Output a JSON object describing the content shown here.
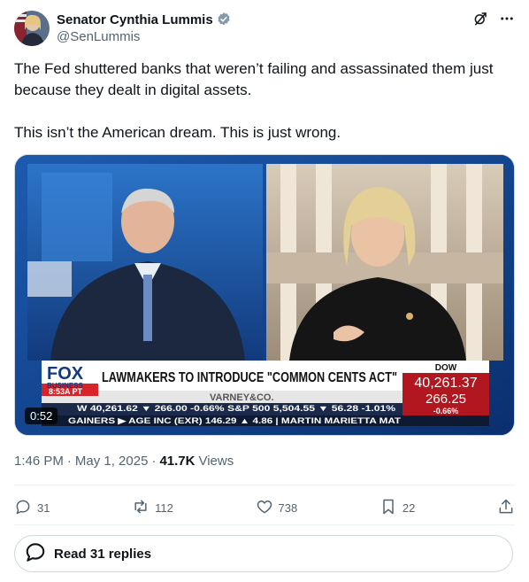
{
  "author": {
    "name": "Senator Cynthia Lummis",
    "handle": "@SenLummis",
    "verified": true
  },
  "tweet": {
    "paragraphs": [
      "The Fed shuttered banks that weren’t failing and assassinated them just because they dealt in digital assets.",
      "This isn’t the American dream. This is just wrong."
    ]
  },
  "media": {
    "duration": "0:52",
    "ticker": {
      "network_top": "FOX",
      "network_sub": "BUSINESS",
      "time": "8:53A PT",
      "headline": "LAWMAKERS TO INTRODUCE \"COMMON CENTS ACT\"",
      "show": "VARNEY&CO.",
      "index_label": "DOW",
      "index_value": "40,261.37",
      "index_change": "266.25",
      "index_pct": "-0.66%",
      "row1": "W   40,261.62 ▼ 266.00 -0.66% S&P 500   5,504.55 ▼ 56.28 -1.01%",
      "row2": "GAINERS ▶ AGE INC (EXR)  146.29 ▲ 4.86 | MARTIN MARIETTA MAT"
    }
  },
  "meta": {
    "time": "1:46 PM",
    "date": "May 1, 2025",
    "views_count": "41.7K",
    "views_label": "Views"
  },
  "actions": {
    "replies": "31",
    "reposts": "112",
    "likes": "738",
    "bookmarks": "22"
  },
  "read_replies": "Read 31 replies",
  "colors": {
    "text": "#0f1419",
    "secondary": "#536471",
    "verified": "#829aab",
    "border": "#cfd9de"
  }
}
